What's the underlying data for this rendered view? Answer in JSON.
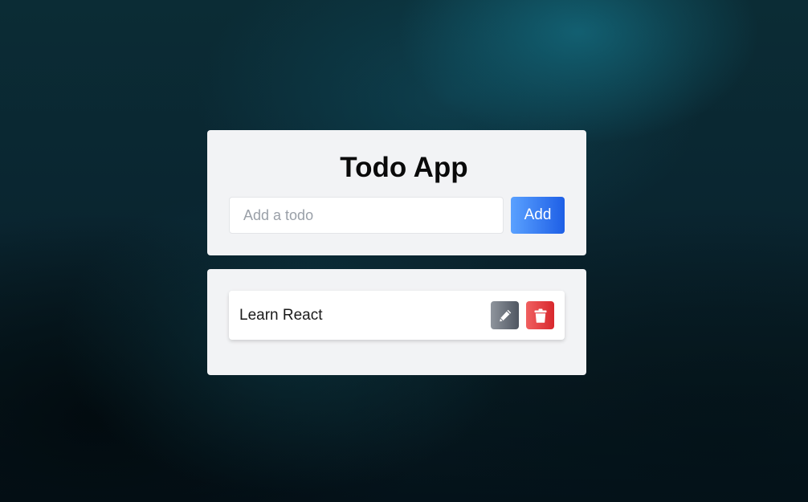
{
  "app": {
    "title": "Todo App"
  },
  "new_todo": {
    "placeholder": "Add a todo",
    "value": "",
    "add_label": "Add"
  },
  "todos": [
    {
      "text": "Learn React",
      "actions": [
        {
          "name": "edit",
          "icon": "pencil-icon",
          "color": "#6b717b"
        },
        {
          "name": "delete",
          "icon": "trash-icon",
          "color": "#e53e3e"
        }
      ]
    }
  ],
  "colors": {
    "accent": "#3b82f6",
    "card_background": "#f2f3f5",
    "edit": "#6b717b",
    "delete": "#e53e3e"
  }
}
